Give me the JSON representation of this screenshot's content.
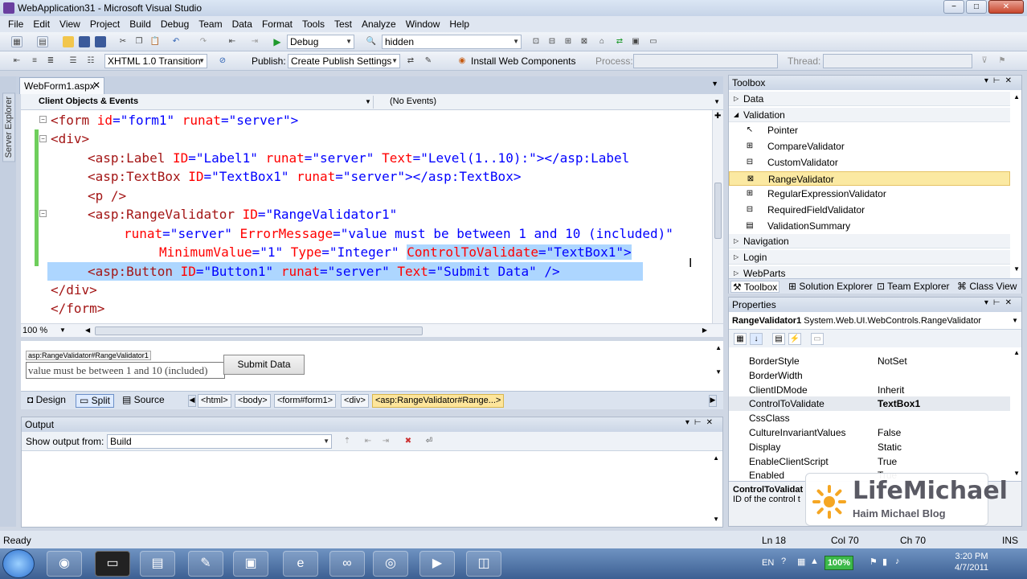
{
  "window": {
    "title": "WebApplication31 - Microsoft Visual Studio",
    "min": "−",
    "max": "□",
    "close": "✕"
  },
  "menu": [
    "File",
    "Edit",
    "View",
    "Project",
    "Build",
    "Debug",
    "Team",
    "Data",
    "Format",
    "Tools",
    "Test",
    "Analyze",
    "Window",
    "Help"
  ],
  "toolbar1": {
    "config": "Debug",
    "search": "hidden"
  },
  "toolbar2": {
    "doctype": "XHTML 1.0 Transition",
    "publish_label": "Publish:",
    "publish_value": "Create Publish Settings",
    "install": "Install Web Components",
    "process_label": "Process:",
    "thread_label": "Thread:"
  },
  "server_explorer": "Server Explorer",
  "doc_tab": {
    "label": "WebForm1.aspx",
    "close": "✕"
  },
  "nav": {
    "left": "Client Objects & Events",
    "right": "(No Events)"
  },
  "code": {
    "l1": [
      "<form ",
      "id",
      "=\"form1\" ",
      "runat",
      "=\"server\">"
    ],
    "l2": "<div>",
    "l3a": "<asp:Label ",
    "l3b": "ID",
    "l3c": "=\"Label1\" ",
    "l3d": "runat",
    "l3e": "=\"server\" ",
    "l3f": "Text",
    "l3g": "=\"Level(1..10):\"></asp:Label",
    "l4a": "<asp:TextBox ",
    "l4b": "ID",
    "l4c": "=\"TextBox1\" ",
    "l4d": "runat",
    "l4e": "=\"server\"></asp:TextBox>",
    "l5": "<p />",
    "l6a": "<asp:RangeValidator ",
    "l6b": "ID",
    "l6c": "=\"RangeValidator1\"",
    "l7a": "runat",
    "l7b": "=\"server\" ",
    "l7c": "ErrorMessage",
    "l7d": "=\"value must be between 1 and 10 (included)\"",
    "l8a": "MinimumValue",
    "l8b": "=\"1\" ",
    "l8c": "Type",
    "l8d": "=\"Integer\" ",
    "l8e": "ControlToValidate",
    "l8f": "=\"TextBox1\">",
    "l9a": "<asp:Button ",
    "l9b": "ID",
    "l9c": "=\"Button1\" ",
    "l9d": "runat",
    "l9e": "=\"server\" ",
    "l9f": "Text",
    "l9g": "=\"Submit Data\" />",
    "l10": "</div>",
    "l11": "</form>"
  },
  "zoom": "100 %",
  "design": {
    "tag": "asp:RangeValidator#RangeValidator1",
    "message": "value must be between 1 and 10 (included)",
    "button": "Submit Data"
  },
  "views": {
    "design": "Design",
    "split": "Split",
    "source": "Source"
  },
  "crumbs": [
    "<html>",
    "<body>",
    "<form#form1>",
    "<div>",
    "<asp:RangeValidator#Range...>"
  ],
  "output": {
    "title": "Output",
    "show_label": "Show output from:",
    "source": "Build"
  },
  "toolbox": {
    "title": "Toolbox",
    "rows": [
      {
        "kind": "cat",
        "label": "Data",
        "arrow": "▷"
      },
      {
        "kind": "cat",
        "label": "Validation",
        "arrow": "◢"
      },
      {
        "kind": "item",
        "label": "Pointer",
        "icon": "↖"
      },
      {
        "kind": "item",
        "label": "CompareValidator",
        "icon": "⊞"
      },
      {
        "kind": "item",
        "label": "CustomValidator",
        "icon": "⊟"
      },
      {
        "kind": "item",
        "label": "RangeValidator",
        "icon": "⊠",
        "selected": true
      },
      {
        "kind": "item",
        "label": "RegularExpressionValidator",
        "icon": "⊞"
      },
      {
        "kind": "item",
        "label": "RequiredFieldValidator",
        "icon": "⊟"
      },
      {
        "kind": "item",
        "label": "ValidationSummary",
        "icon": "▤"
      },
      {
        "kind": "cat",
        "label": "Navigation",
        "arrow": "▷"
      },
      {
        "kind": "cat",
        "label": "Login",
        "arrow": "▷"
      },
      {
        "kind": "cat",
        "label": "WebParts",
        "arrow": "▷"
      }
    ],
    "tabs": [
      "Toolbox",
      "Solution Explorer",
      "Team Explorer",
      "Class View"
    ]
  },
  "properties": {
    "title": "Properties",
    "object": "RangeValidator1",
    "object_type": "System.Web.UI.WebControls.RangeValidator",
    "rows": [
      {
        "name": "BorderStyle",
        "value": "NotSet"
      },
      {
        "name": "BorderWidth",
        "value": ""
      },
      {
        "name": "ClientIDMode",
        "value": "Inherit"
      },
      {
        "name": "ControlToValidate",
        "value": "TextBox1",
        "bold": true,
        "selected": true
      },
      {
        "name": "CssClass",
        "value": ""
      },
      {
        "name": "CultureInvariantValues",
        "value": "False"
      },
      {
        "name": "Display",
        "value": "Static"
      },
      {
        "name": "EnableClientScript",
        "value": "True"
      },
      {
        "name": "Enabled",
        "value": "True"
      }
    ],
    "desc_title": "ControlToValidat",
    "desc_text": "ID of the control t"
  },
  "watermark": {
    "brand": "LifeMichael",
    "sub": "Haim Michael Blog"
  },
  "status": {
    "ready": "Ready",
    "ln": "Ln 18",
    "col": "Col 70",
    "ch": "Ch 70",
    "mode": "INS"
  },
  "tray": {
    "lang": "EN",
    "battery": "100%",
    "time": "3:20 PM",
    "date": "4/7/2011"
  }
}
